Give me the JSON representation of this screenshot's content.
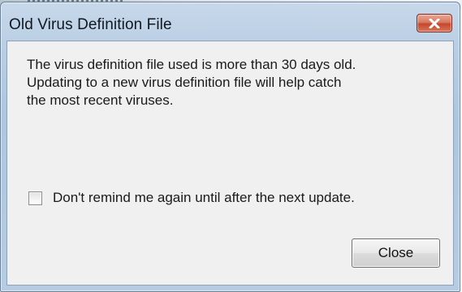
{
  "dialog": {
    "title": "Old Virus Definition File",
    "close_icon": "close-icon",
    "message_lines": [
      "The virus definition file used is more than 30 days old.",
      "Updating to a new virus definition file will help catch",
      "the most recent viruses."
    ],
    "checkbox": {
      "label": "Don't remind me again until after the next update.",
      "checked": false
    },
    "close_button_label": "Close"
  },
  "colors": {
    "titlebar": "#b8cde3",
    "close_accent": "#c4472c",
    "client_bg": "#f0f0f0"
  }
}
